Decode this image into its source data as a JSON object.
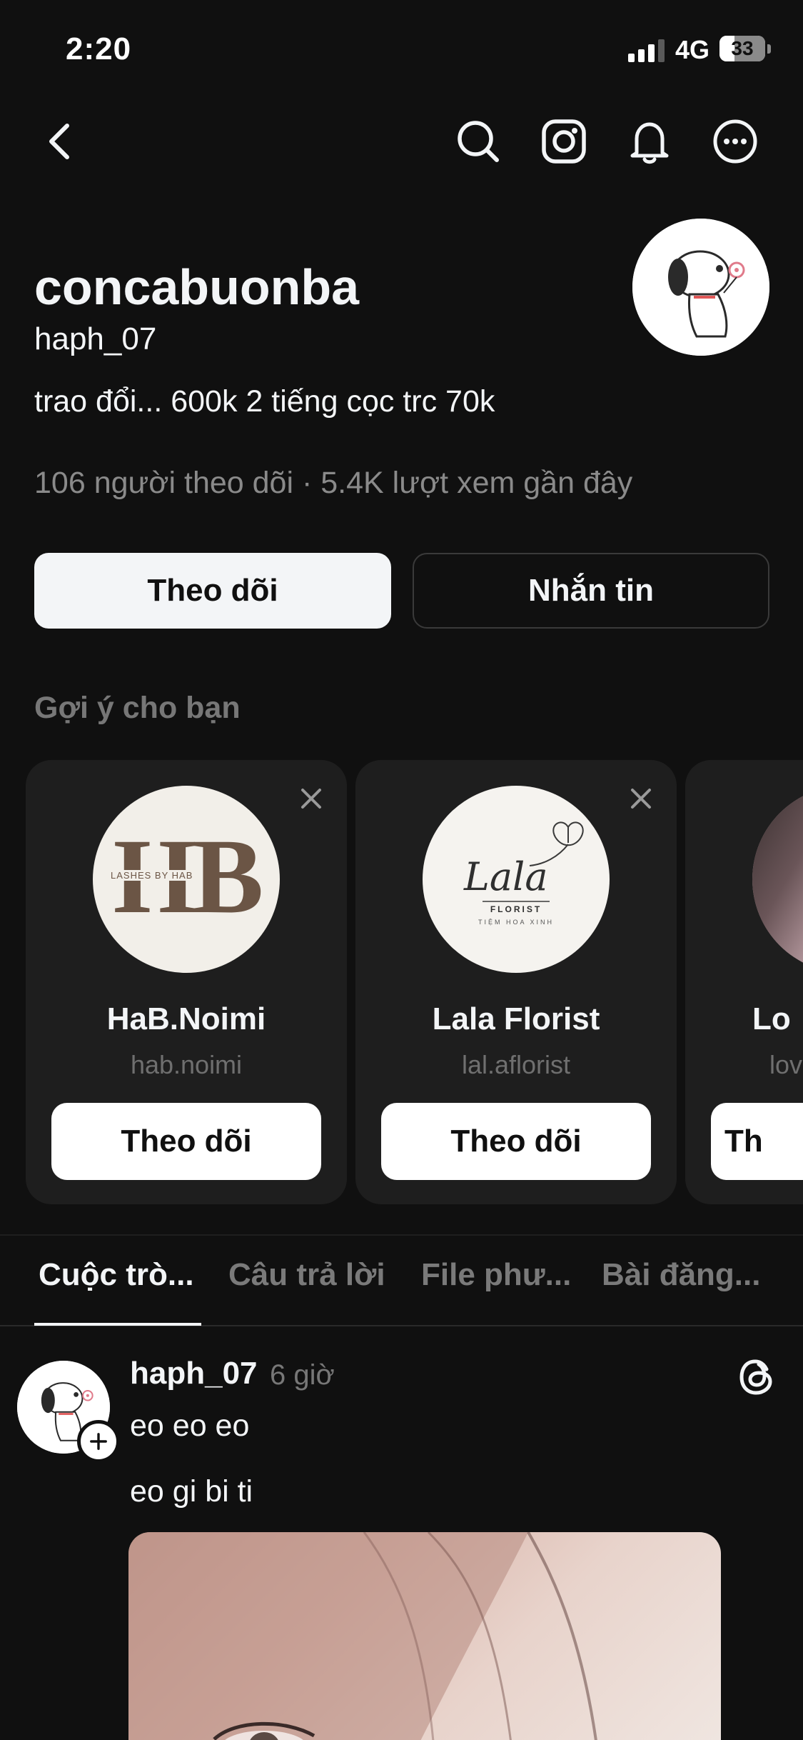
{
  "status_bar": {
    "time": "2:20",
    "network": "4G",
    "battery": "33",
    "battery_level": 0.33
  },
  "nav": {
    "back_icon": "chevron-left-icon",
    "search_icon": "search-icon",
    "instagram_icon": "instagram-icon",
    "bell_icon": "bell-icon",
    "more_icon": "more-icon"
  },
  "profile": {
    "display_name": "concabuonba",
    "handle": "haph_07",
    "bio": "trao đổi... 600k 2 tiếng cọc trc 70k",
    "stats": "106 người theo dõi · 5.4K lượt xem gần đây",
    "follow_label": "Theo dõi",
    "message_label": "Nhắn tin"
  },
  "suggestions": {
    "title": "Gợi ý cho bạn",
    "cards": [
      {
        "name": "HaB.Noimi",
        "handle": "hab.noimi",
        "follow_label": "Theo dõi",
        "logo_big": "HB",
        "logo_small": "LASHES BY HAB"
      },
      {
        "name": "Lala Florist",
        "handle": "lal.aflorist",
        "follow_label": "Theo dõi",
        "logo_script": "Lala",
        "logo_sub1": "FLORIST",
        "logo_sub2": "TIỆM HOA XINH"
      },
      {
        "name": "Lo",
        "handle": "lov",
        "follow_label": "Th"
      }
    ]
  },
  "tabs": [
    "Cuộc trò...",
    "Câu trả lời",
    "File phư...",
    "Bài đăng..."
  ],
  "post": {
    "user": "haph_07",
    "time": "6 giờ",
    "line1": "eo eo eo",
    "line2": "eo gi bi ti"
  },
  "colors": {
    "background": "#101010",
    "text": "#f3f5f7",
    "muted": "#8a8a8a",
    "card": "#1e1e1e"
  }
}
